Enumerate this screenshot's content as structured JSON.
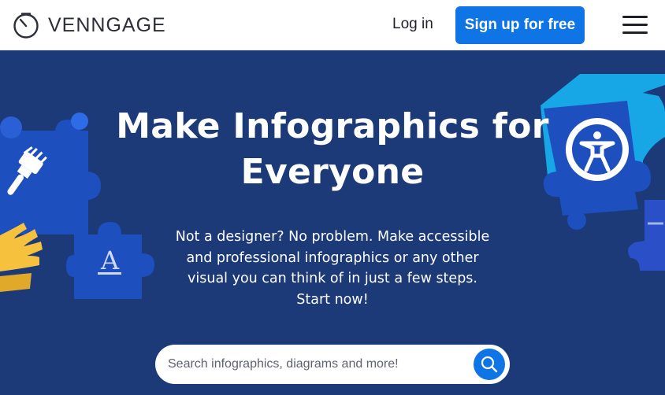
{
  "brand": {
    "name": "VENNGAGE"
  },
  "nav": {
    "login": "Log in",
    "signup": "Sign up for free",
    "menu_icon": "hamburger-menu-icon"
  },
  "hero": {
    "headline_line1": "Make Infographics for",
    "headline_line2": "Everyone",
    "subtext_line1": "Not a designer? No problem. Make accessible",
    "subtext_line2": "and professional infographics or any other",
    "subtext_line3": "visual you can think of in just a few steps.",
    "subtext_line4": "Start now!"
  },
  "search": {
    "placeholder": "Search infographics, diagrams and more!",
    "icon": "search-icon"
  },
  "colors": {
    "hero_bg": "#1c3a78",
    "accent_blue": "#0f74e6",
    "puzzle_blue": "#1d4fbf",
    "cyan": "#17a6e6",
    "yellow": "#f6c23e"
  }
}
